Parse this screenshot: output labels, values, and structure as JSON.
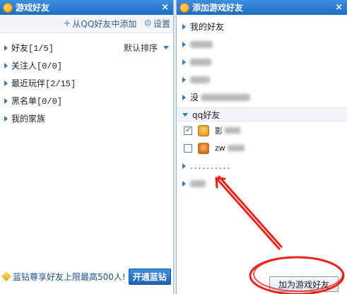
{
  "left_panel": {
    "title": "游戏好友",
    "close": "×",
    "toolbar": {
      "add_from_qq": "从QQ好友中添加",
      "settings": "设置"
    },
    "groups": [
      {
        "label": "好友[1/5]"
      },
      {
        "label": "关注人[0/0]"
      },
      {
        "label": "最近玩伴[2/15]"
      },
      {
        "label": "黑名单[0/0]"
      },
      {
        "label": "我的家族"
      }
    ],
    "sort_label": "默认排序",
    "promo_text": "蓝钻尊享好友上限最高500人!",
    "open_button": "开通蓝钻"
  },
  "right_panel": {
    "title": "添加游戏好友",
    "close": "×",
    "my_friends_label": "我的好友",
    "partial_row_prefix": "没",
    "qq_friends_header": "qq好友",
    "friends": [
      {
        "name_visible": "影",
        "checked": true
      },
      {
        "name_visible": "zw",
        "checked": false
      }
    ],
    "dots_row": "..........",
    "add_button": "加为游戏好友"
  },
  "colors": {
    "title_bar": "#1d6cc4",
    "accent_blue": "#3a74b8",
    "annotation_red": "#e8231c"
  }
}
